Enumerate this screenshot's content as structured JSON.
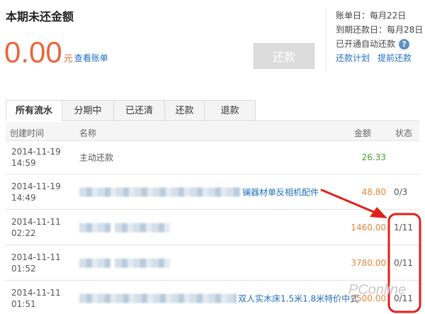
{
  "summary": {
    "title": "本期未还金额",
    "amount": "0.00",
    "unit": "元",
    "view_bill": "查看账单",
    "repay_button": "还款"
  },
  "side_info": {
    "bill_day": "账单日：每月22日",
    "due_day": "到期还款日：每月28日",
    "auto_repay": "已开通自动还款",
    "links": [
      "还款计划",
      "提前还款"
    ]
  },
  "tabs": [
    "所有流水",
    "分期中",
    "已还清",
    "还款",
    "退款"
  ],
  "table": {
    "headers": {
      "created": "创建时间",
      "name": "名称",
      "amount": "金额",
      "status": "状态"
    },
    "rows": [
      {
        "date": "2014-11-19",
        "time": "14:59",
        "name": "主动还款",
        "amount": "26.33",
        "status": ""
      },
      {
        "date": "2014-11-19",
        "time": "14:49",
        "name": "镧器材单反相机配件",
        "amount": "48.80",
        "status": "0/3"
      },
      {
        "date": "2014-11-11",
        "time": "02:22",
        "name": "",
        "amount": "1460.00",
        "status": "1/11"
      },
      {
        "date": "2014-11-11",
        "time": "01:52",
        "name": "",
        "amount": "3780.00",
        "status": "0/11"
      },
      {
        "date": "2014-11-11",
        "time": "01:51",
        "name": "双人实木床1.5米1.8米特价中式",
        "amount": "2500.00",
        "status": "0/11"
      }
    ]
  },
  "watermark": "PConline",
  "colors": {
    "amount": "#e8663b",
    "link": "#1e6fbf",
    "annotation": "#e0201b"
  }
}
